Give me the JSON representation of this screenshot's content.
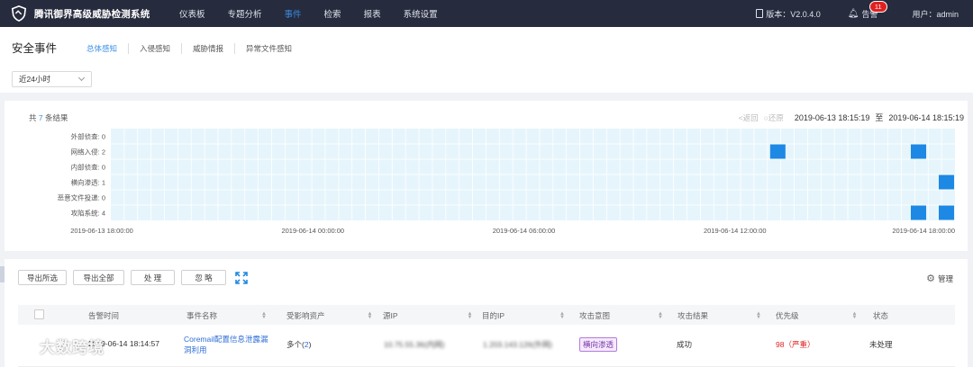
{
  "app": {
    "title": "腾讯御界高级威胁检测系统",
    "nav": [
      "仪表板",
      "专题分析",
      "事件",
      "检索",
      "报表",
      "系统设置"
    ],
    "active_nav": "事件",
    "version_label": "版本：V2.0.4.0",
    "alarm_label": "告警",
    "alarm_count": "11",
    "user_label": "用户：admin"
  },
  "page": {
    "title": "安全事件",
    "subtabs": [
      "总体感知",
      "入侵感知",
      "威胁情报",
      "异常文件感知"
    ],
    "active_subtab": "总体感知",
    "time_select": "近24小时"
  },
  "chart_panel": {
    "result_prefix": "共",
    "result_count": "7",
    "result_suffix": "条结果",
    "back_label": "<返回",
    "forward_label": "○还原",
    "range_start": "2019-06-13 18:15:19",
    "range_sep": "至",
    "range_end": "2019-06-14 18:15:19"
  },
  "chart_data": {
    "type": "heatmap",
    "rows": [
      {
        "label": "外部侦查:",
        "count": "0"
      },
      {
        "label": "网络入侵:",
        "count": "2"
      },
      {
        "label": "内部侦查:",
        "count": "0"
      },
      {
        "label": "横向渗透:",
        "count": "1"
      },
      {
        "label": "恶意文件投递:",
        "count": "0"
      },
      {
        "label": "攻陷系统:",
        "count": "4"
      }
    ],
    "x_ticks": [
      "2019-06-13 18:00:00",
      "2019-06-14 00:00:00",
      "2019-06-14 06:00:00",
      "2019-06-14 12:00:00",
      "2019-06-14 18:00:00"
    ],
    "x_range": [
      "2019-06-13 18:15:19",
      "2019-06-14 18:15:19"
    ],
    "cells": [
      {
        "row": 1,
        "time": "2019-06-14 13:00"
      },
      {
        "row": 1,
        "time": "2019-06-14 17:00"
      },
      {
        "row": 3,
        "time": "2019-06-14 18:00"
      },
      {
        "row": 5,
        "time": "2019-06-14 17:00"
      },
      {
        "row": 5,
        "time": "2019-06-14 18:00"
      }
    ],
    "colors": {
      "background": "#e6f5fc",
      "cell": "#1e88e5",
      "grid": "#ffffff"
    }
  },
  "toolbar": {
    "export_selected": "导出所选",
    "export_all": "导出全部",
    "handle": "处 理",
    "ignore": "忽 略",
    "manage": "管理"
  },
  "table": {
    "columns": [
      "告警时间",
      "事件名称",
      "受影响资产",
      "源IP",
      "目的IP",
      "攻击意图",
      "攻击结果",
      "优先级",
      "状态"
    ],
    "rows": [
      {
        "time": "2019-06-14 18:14:57",
        "event_name": "Coremail配置信息泄露漏洞利用",
        "asset": "多个(",
        "asset_count": "2",
        "asset_close": ")",
        "src_ip": "10.75.55.36(内网)",
        "dst_ip": "1.203.143.126(外网)",
        "intent": "横向渗透",
        "result": "成功",
        "priority": "98（严重）",
        "status": "未处理"
      }
    ]
  },
  "watermark": "大数跨境"
}
